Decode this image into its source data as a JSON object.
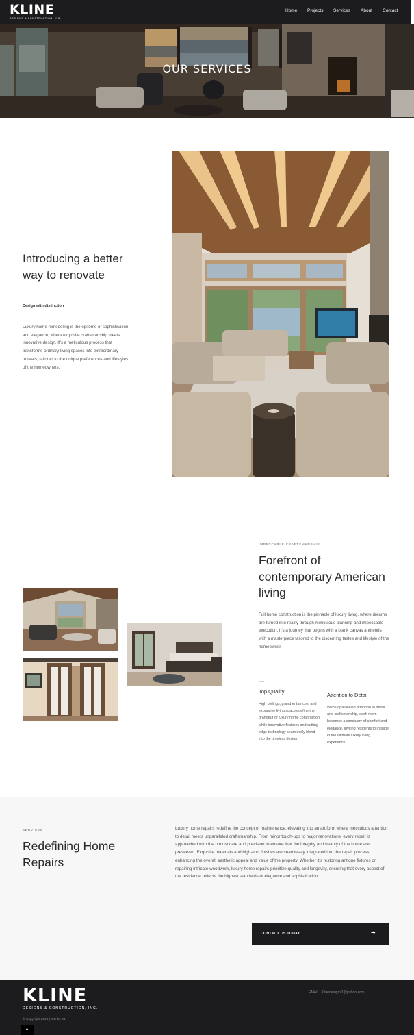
{
  "brand": {
    "name": "KLINE",
    "tagline": "DESIGNS & CONSTRUCTION, INC."
  },
  "nav": [
    {
      "label": "Home"
    },
    {
      "label": "Projects"
    },
    {
      "label": "Services"
    },
    {
      "label": "About"
    },
    {
      "label": "Contact"
    }
  ],
  "hero": {
    "title": "OUR SERVICES"
  },
  "intro": {
    "title": "Introducing a better way to renovate",
    "tagline": "Design with distinction",
    "body": "Luxury home remodeling is the epitome of sophistication and elegance, where exquisite craftsmanship meets innovative design. It's a meticulous process that transforms ordinary living spaces into extraordinary retreats, tailored to the unique preferences and lifestyles of the homeowners."
  },
  "craftsmanship": {
    "eyebrow": "IMPECCABLE CRAFTSMANSHIP",
    "title": "Forefront of contemporary American living",
    "body": "Full home construction is the pinnacle of luxury living, where dreams are turned into reality through meticulous planning and impeccable execution. It's a journey that begins with a blank canvas and ends with a masterpiece tailored to the discerning tastes and lifestyle of the homeowner.",
    "columns": [
      {
        "title": "Top Quality",
        "body": "High ceilings, grand entrances, and expansive living spaces define the grandeur of luxury home construction, while innovative features and cutting-edge technology seamlessly blend into the timeless design."
      },
      {
        "title": "Attention to Detail",
        "body": "With unparalleled attention to detail and craftsmanship, each room becomes a sanctuary of comfort and elegance, inviting residents to indulge in the ultimate luxury living experience."
      }
    ]
  },
  "repairs": {
    "eyebrow": "SERVICES",
    "title": "Redefining Home Repairs",
    "body": "Luxury home repairs redefine the concept of maintenance, elevating it to an art form where meticulous attention to detail meets unparalleled craftsmanship. From minor touch-ups to major renovations, every repair is approached with the utmost care and precision to ensure that the integrity and beauty of the home are preserved. Exquisite materials and high-end finishes are seamlessly integrated into the repair process, enhancing the overall aesthetic appeal and value of the property. Whether it's restoring antique fixtures or repairing intricate woodwork, luxury home repairs prioritize quality and longevity, ensuring that every aspect of the residence reflects the highest standards of elegance and sophistication.",
    "cta_label": "CONTACT US TODAY",
    "cta_icon": "arrow-right-icon"
  },
  "footer": {
    "email": "EMAIL: Klinedesigns1@yahoo.com",
    "copyright": "© Copyright 2020 | Site by 91",
    "scroll_icon": "chevron-up-icon"
  },
  "colors": {
    "dark": "#1c1c1e",
    "light_bg": "#f7f7f7",
    "body_text": "#555555"
  }
}
